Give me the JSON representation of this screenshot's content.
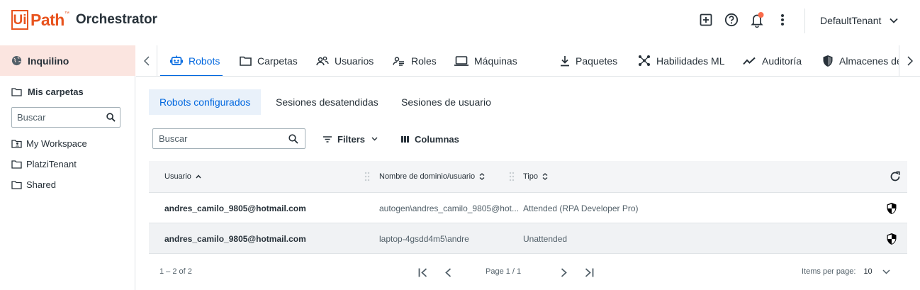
{
  "header": {
    "logo_mark": "Ui",
    "logo_path": "Path",
    "logo_tm": "™",
    "product": "Orchestrator",
    "tenant": "DefaultTenant",
    "icons": [
      "add-icon",
      "help-icon",
      "bell-icon",
      "more-vert-icon",
      "chevron-down-icon"
    ],
    "notification_color": "#fa6b4a"
  },
  "sidebar": {
    "tenant_label": "Inquilino",
    "folders_title": "Mis carpetas",
    "search_placeholder": "Buscar",
    "folders": [
      {
        "label": "My Workspace",
        "icon": "personal-folder-icon"
      },
      {
        "label": "PlatziTenant",
        "icon": "folder-icon"
      },
      {
        "label": "Shared",
        "icon": "folder-icon"
      }
    ]
  },
  "tabs": [
    {
      "label": "Robots",
      "icon": "robot-icon",
      "active": true
    },
    {
      "label": "Carpetas",
      "icon": "folder-icon"
    },
    {
      "label": "Usuarios",
      "icon": "users-icon"
    },
    {
      "label": "Roles",
      "icon": "roles-icon"
    },
    {
      "label": "Máquinas",
      "icon": "laptop-icon"
    },
    {
      "label": "Paquetes",
      "icon": "download-icon"
    },
    {
      "label": "Habilidades ML",
      "icon": "ml-icon"
    },
    {
      "label": "Auditoría",
      "icon": "trend-icon"
    },
    {
      "label": "Almacenes de cred",
      "icon": "shield-icon"
    }
  ],
  "subtabs": [
    {
      "label": "Robots configurados",
      "active": true
    },
    {
      "label": "Sesiones desatendidas"
    },
    {
      "label": "Sesiones de usuario"
    }
  ],
  "toolbar": {
    "search_placeholder": "Buscar",
    "filters_label": "Filters",
    "columns_label": "Columnas"
  },
  "table": {
    "columns": [
      "Usuario",
      "Nombre de dominio/usuario",
      "Tipo"
    ],
    "rows": [
      {
        "user": "andres_camilo_9805@hotmail.com",
        "domain": "autogen\\andres_camilo_9805@hot...",
        "type": "Attended (RPA Developer Pro)",
        "icon": "shield-icon"
      },
      {
        "user": "andres_camilo_9805@hotmail.com",
        "domain": "laptop-4gsdd4m5\\andre",
        "type": "Unattended",
        "icon": "shield-icon"
      }
    ]
  },
  "pagination": {
    "range": "1 – 2 of 2",
    "page": "Page 1 / 1",
    "items_per_page_label": "Items per page:",
    "items_per_page": "10"
  },
  "colors": {
    "brand": "#e8541f",
    "accent": "#0067df",
    "sidebar_active_bg": "#fbe5e0"
  }
}
